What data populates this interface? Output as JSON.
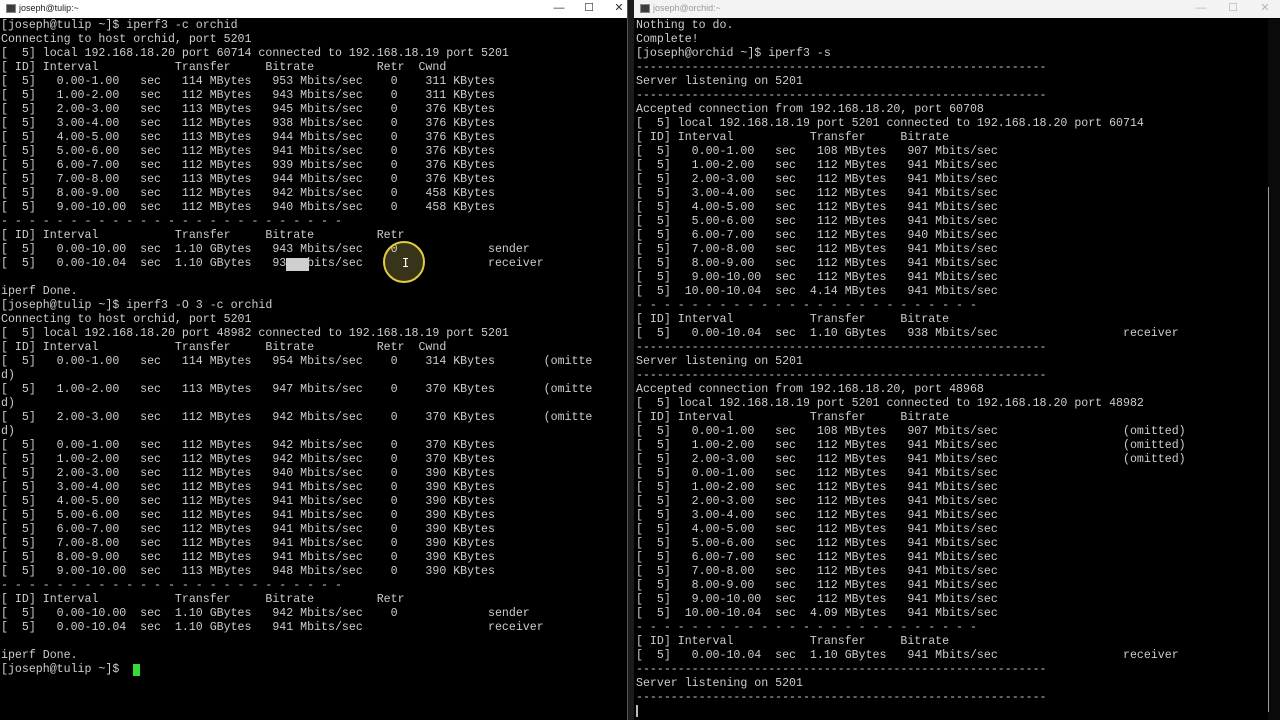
{
  "left_window": {
    "title": "joseph@tulip:~",
    "buttons": {
      "minimize": "—",
      "maximize": "☐",
      "close": "✕"
    },
    "lines": [
      "[joseph@tulip ~]$ iperf3 -c orchid",
      "Connecting to host orchid, port 5201",
      "[  5] local 192.168.18.20 port 60714 connected to 192.168.18.19 port 5201",
      "[ ID] Interval           Transfer     Bitrate         Retr  Cwnd",
      "[  5]   0.00-1.00   sec   114 MBytes   953 Mbits/sec    0    311 KBytes",
      "[  5]   1.00-2.00   sec   112 MBytes   943 Mbits/sec    0    311 KBytes",
      "[  5]   2.00-3.00   sec   113 MBytes   945 Mbits/sec    0    376 KBytes",
      "[  5]   3.00-4.00   sec   112 MBytes   938 Mbits/sec    0    376 KBytes",
      "[  5]   4.00-5.00   sec   113 MBytes   944 Mbits/sec    0    376 KBytes",
      "[  5]   5.00-6.00   sec   112 MBytes   941 Mbits/sec    0    376 KBytes",
      "[  5]   6.00-7.00   sec   112 MBytes   939 Mbits/sec    0    376 KBytes",
      "[  5]   7.00-8.00   sec   113 MBytes   944 Mbits/sec    0    376 KBytes",
      "[  5]   8.00-9.00   sec   112 MBytes   942 Mbits/sec    0    458 KBytes",
      "[  5]   9.00-10.00  sec   112 MBytes   940 Mbits/sec    0    458 KBytes",
      "- - - - - - - - - - - - - - - - - - - - - - - - -",
      "[ ID] Interval           Transfer     Bitrate         Retr",
      "[  5]   0.00-10.00  sec  1.10 GBytes   943 Mbits/sec    0             sender",
      "[  5]   0.00-10.04  sec  1.10 GBytes   938 Mbits/sec                  receiver",
      "",
      "iperf Done.",
      "[joseph@tulip ~]$ iperf3 -O 3 -c orchid",
      "Connecting to host orchid, port 5201",
      "[  5] local 192.168.18.20 port 48982 connected to 192.168.18.19 port 5201",
      "[ ID] Interval           Transfer     Bitrate         Retr  Cwnd",
      "[  5]   0.00-1.00   sec   114 MBytes   954 Mbits/sec    0    314 KBytes       (omitte",
      "d)",
      "[  5]   1.00-2.00   sec   113 MBytes   947 Mbits/sec    0    370 KBytes       (omitte",
      "d)",
      "[  5]   2.00-3.00   sec   112 MBytes   942 Mbits/sec    0    370 KBytes       (omitte",
      "d)",
      "[  5]   0.00-1.00   sec   112 MBytes   942 Mbits/sec    0    370 KBytes",
      "[  5]   1.00-2.00   sec   112 MBytes   942 Mbits/sec    0    370 KBytes",
      "[  5]   2.00-3.00   sec   112 MBytes   940 Mbits/sec    0    390 KBytes",
      "[  5]   3.00-4.00   sec   112 MBytes   941 Mbits/sec    0    390 KBytes",
      "[  5]   4.00-5.00   sec   112 MBytes   941 Mbits/sec    0    390 KBytes",
      "[  5]   5.00-6.00   sec   112 MBytes   941 Mbits/sec    0    390 KBytes",
      "[  5]   6.00-7.00   sec   112 MBytes   941 Mbits/sec    0    390 KBytes",
      "[  5]   7.00-8.00   sec   112 MBytes   941 Mbits/sec    0    390 KBytes",
      "[  5]   8.00-9.00   sec   112 MBytes   941 Mbits/sec    0    390 KBytes",
      "[  5]   9.00-10.00  sec   113 MBytes   948 Mbits/sec    0    390 KBytes",
      "- - - - - - - - - - - - - - - - - - - - - - - - -",
      "[ ID] Interval           Transfer     Bitrate         Retr",
      "[  5]   0.00-10.00  sec  1.10 GBytes   942 Mbits/sec    0             sender",
      "[  5]   0.00-10.04  sec  1.10 GBytes   941 Mbits/sec                  receiver",
      "",
      "iperf Done.",
      "[joseph@tulip ~]$ "
    ]
  },
  "right_window": {
    "title": "joseph@orchid:~",
    "buttons": {
      "minimize": "—",
      "maximize": "☐",
      "close": "✕"
    },
    "lines": [
      "Nothing to do.",
      "Complete!",
      "[joseph@orchid ~]$ iperf3 -s",
      "-----------------------------------------------------------",
      "Server listening on 5201",
      "-----------------------------------------------------------",
      "Accepted connection from 192.168.18.20, port 60708",
      "[  5] local 192.168.18.19 port 5201 connected to 192.168.18.20 port 60714",
      "[ ID] Interval           Transfer     Bitrate",
      "[  5]   0.00-1.00   sec   108 MBytes   907 Mbits/sec",
      "[  5]   1.00-2.00   sec   112 MBytes   941 Mbits/sec",
      "[  5]   2.00-3.00   sec   112 MBytes   941 Mbits/sec",
      "[  5]   3.00-4.00   sec   112 MBytes   941 Mbits/sec",
      "[  5]   4.00-5.00   sec   112 MBytes   941 Mbits/sec",
      "[  5]   5.00-6.00   sec   112 MBytes   941 Mbits/sec",
      "[  5]   6.00-7.00   sec   112 MBytes   940 Mbits/sec",
      "[  5]   7.00-8.00   sec   112 MBytes   941 Mbits/sec",
      "[  5]   8.00-9.00   sec   112 MBytes   941 Mbits/sec",
      "[  5]   9.00-10.00  sec   112 MBytes   941 Mbits/sec",
      "[  5]  10.00-10.04  sec  4.14 MBytes   941 Mbits/sec",
      "- - - - - - - - - - - - - - - - - - - - - - - - -",
      "[ ID] Interval           Transfer     Bitrate",
      "[  5]   0.00-10.04  sec  1.10 GBytes   938 Mbits/sec                  receiver",
      "-----------------------------------------------------------",
      "Server listening on 5201",
      "-----------------------------------------------------------",
      "Accepted connection from 192.168.18.20, port 48968",
      "[  5] local 192.168.18.19 port 5201 connected to 192.168.18.20 port 48982",
      "[ ID] Interval           Transfer     Bitrate",
      "[  5]   0.00-1.00   sec   108 MBytes   907 Mbits/sec                  (omitted)",
      "[  5]   1.00-2.00   sec   112 MBytes   941 Mbits/sec                  (omitted)",
      "[  5]   2.00-3.00   sec   112 MBytes   941 Mbits/sec                  (omitted)",
      "[  5]   0.00-1.00   sec   112 MBytes   941 Mbits/sec",
      "[  5]   1.00-2.00   sec   112 MBytes   941 Mbits/sec",
      "[  5]   2.00-3.00   sec   112 MBytes   941 Mbits/sec",
      "[  5]   3.00-4.00   sec   112 MBytes   941 Mbits/sec",
      "[  5]   4.00-5.00   sec   112 MBytes   941 Mbits/sec",
      "[  5]   5.00-6.00   sec   112 MBytes   941 Mbits/sec",
      "[  5]   6.00-7.00   sec   112 MBytes   941 Mbits/sec",
      "[  5]   7.00-8.00   sec   112 MBytes   941 Mbits/sec",
      "[  5]   8.00-9.00   sec   112 MBytes   941 Mbits/sec",
      "[  5]   9.00-10.00  sec   112 MBytes   941 Mbits/sec",
      "[  5]  10.00-10.04  sec  4.09 MBytes   941 Mbits/sec",
      "- - - - - - - - - - - - - - - - - - - - - - - - -",
      "[ ID] Interval           Transfer     Bitrate",
      "[  5]   0.00-10.04  sec  1.10 GBytes   941 Mbits/sec                  receiver",
      "-----------------------------------------------------------",
      "Server listening on 5201",
      "-----------------------------------------------------------"
    ]
  },
  "colors": {
    "cursor": "#33dd33",
    "click_highlight": "#e3cc3e",
    "text": "#cdcdcd",
    "background": "#000000"
  },
  "icons": [
    "terminal-icon",
    "minimize-icon",
    "maximize-icon",
    "close-icon",
    "text-cursor-icon",
    "click-indicator-icon"
  ]
}
